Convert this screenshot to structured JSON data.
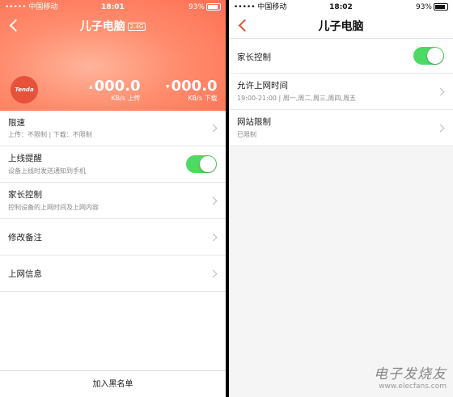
{
  "left": {
    "status": {
      "carrier": "••••• 中国移动",
      "time": "18:01",
      "battery": "93%"
    },
    "nav": {
      "title": "儿子电脑",
      "band": "2.4G"
    },
    "brand": "Tenda",
    "upload": {
      "value": "000.0",
      "unit": "KB/s 上传"
    },
    "download": {
      "value": "000.0",
      "unit": "KB/s 下载"
    },
    "rows": [
      {
        "title": "限速",
        "sub": "上传：不限制 | 下载：不限制"
      },
      {
        "title": "上线提醒",
        "sub": "设备上线时发送通知到手机",
        "toggle": true
      },
      {
        "title": "家长控制",
        "sub": "控制设备的上网时间及上网内容"
      },
      {
        "title": "修改备注"
      },
      {
        "title": "上网信息"
      }
    ],
    "footer": "加入黑名单"
  },
  "right": {
    "status": {
      "carrier": "••••• 中国移动",
      "time": "18:02",
      "battery": "93%"
    },
    "nav": {
      "title": "儿子电脑"
    },
    "rows": [
      {
        "title": "家长控制",
        "toggle": true
      },
      {
        "title": "允许上网时间",
        "sub": "19:00-21:00 | 周一,周二,周三,周四,周五"
      },
      {
        "title": "网站限制",
        "sub": "已限制"
      }
    ]
  },
  "watermark": {
    "text": "电子发烧友",
    "url": "www.elecfans.com"
  },
  "colors": {
    "accent": "#ff7b5e",
    "toggle_on": "#4cd964",
    "back_arrow_right": "#e8513a"
  }
}
